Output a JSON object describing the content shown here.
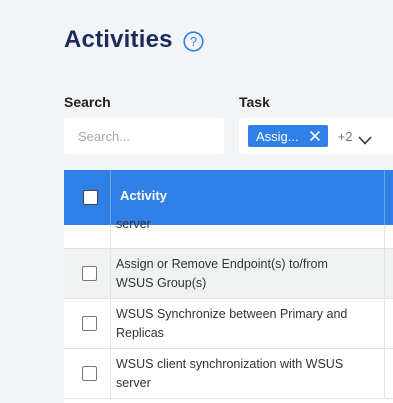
{
  "page": {
    "title": "Activities"
  },
  "filters": {
    "search_label": "Search",
    "search_placeholder": "Search...",
    "search_value": "",
    "task_label": "Task",
    "task_chip": "Assig...",
    "task_more": "+2"
  },
  "table": {
    "header_activity": "Activity",
    "rows": [
      {
        "label": "server",
        "checked": false
      },
      {
        "label": "Assign or Remove Endpoint(s) to/from WSUS Group(s)",
        "checked": false
      },
      {
        "label": "WSUS Synchronize between Primary and Replicas",
        "checked": false
      },
      {
        "label": "WSUS client synchronization with WSUS server",
        "checked": false
      }
    ]
  },
  "colors": {
    "accent": "#2f7fe6",
    "title": "#1e2a5a",
    "background": "#f3f4f6"
  }
}
